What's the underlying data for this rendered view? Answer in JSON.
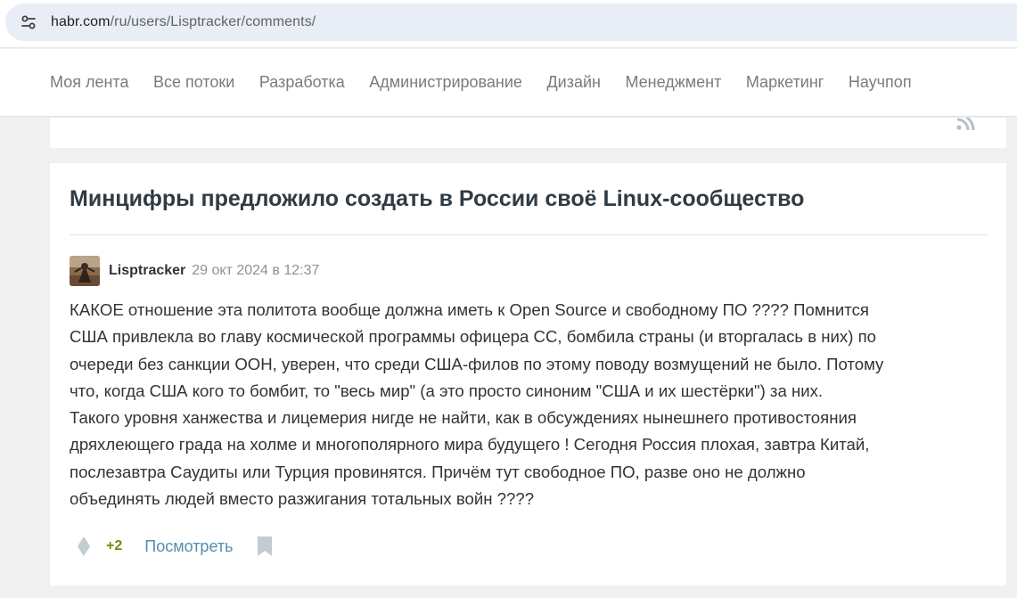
{
  "browser": {
    "url_host": "habr.com",
    "url_path": "/ru/users/Lisptracker/comments/",
    "site_info_icon": "tune-icon"
  },
  "nav": {
    "items": [
      {
        "label": "Моя лента"
      },
      {
        "label": "Все потоки"
      },
      {
        "label": "Разработка"
      },
      {
        "label": "Администрирование"
      },
      {
        "label": "Дизайн"
      },
      {
        "label": "Менеджмент"
      },
      {
        "label": "Маркетинг"
      },
      {
        "label": "Научпоп"
      }
    ]
  },
  "feed": {
    "rss_icon": "rss-icon"
  },
  "comment": {
    "article_title": "Минцифры предложило создать в России своё Linux-сообщество",
    "author": "Lisptracker",
    "date": "29 окт 2024 в 12:37",
    "lines": [
      "КАКОЕ отношение эта политота вообще должна иметь к Open Source и свободному ПО ???? Помнится",
      "США привлекла во главу космической программы офицера СС, бомбила страны (и вторгалась в них) по",
      "очереди без санкции ООН, уверен, что среди США-филов по этому поводу возмущений не было. Потому",
      "что, когда США кого то бомбит, то \"весь мир\" (а это просто синоним \"США и их шестёрки\") за них.",
      "Такого уровня ханжества и лицемерия нигде не найти, как в обсуждениях нынешнего противостояния",
      "дряхлеющего града на холме и многополярного мира будущего ! Сегодня Россия плохая, завтра Китай,",
      "послезавтра Саудиты или Турция провинятся. Причём тут свободное ПО, разве оно не должно",
      "объединять людей вместо разжигания тотальных войн ????"
    ],
    "score": "+2",
    "view_label": "Посмотреть"
  },
  "colors": {
    "title": "#303b44",
    "nav_text": "#7b7b7b",
    "score": "#6c9007",
    "link": "#548eaa",
    "icon_grey": "#c2ccd1"
  }
}
